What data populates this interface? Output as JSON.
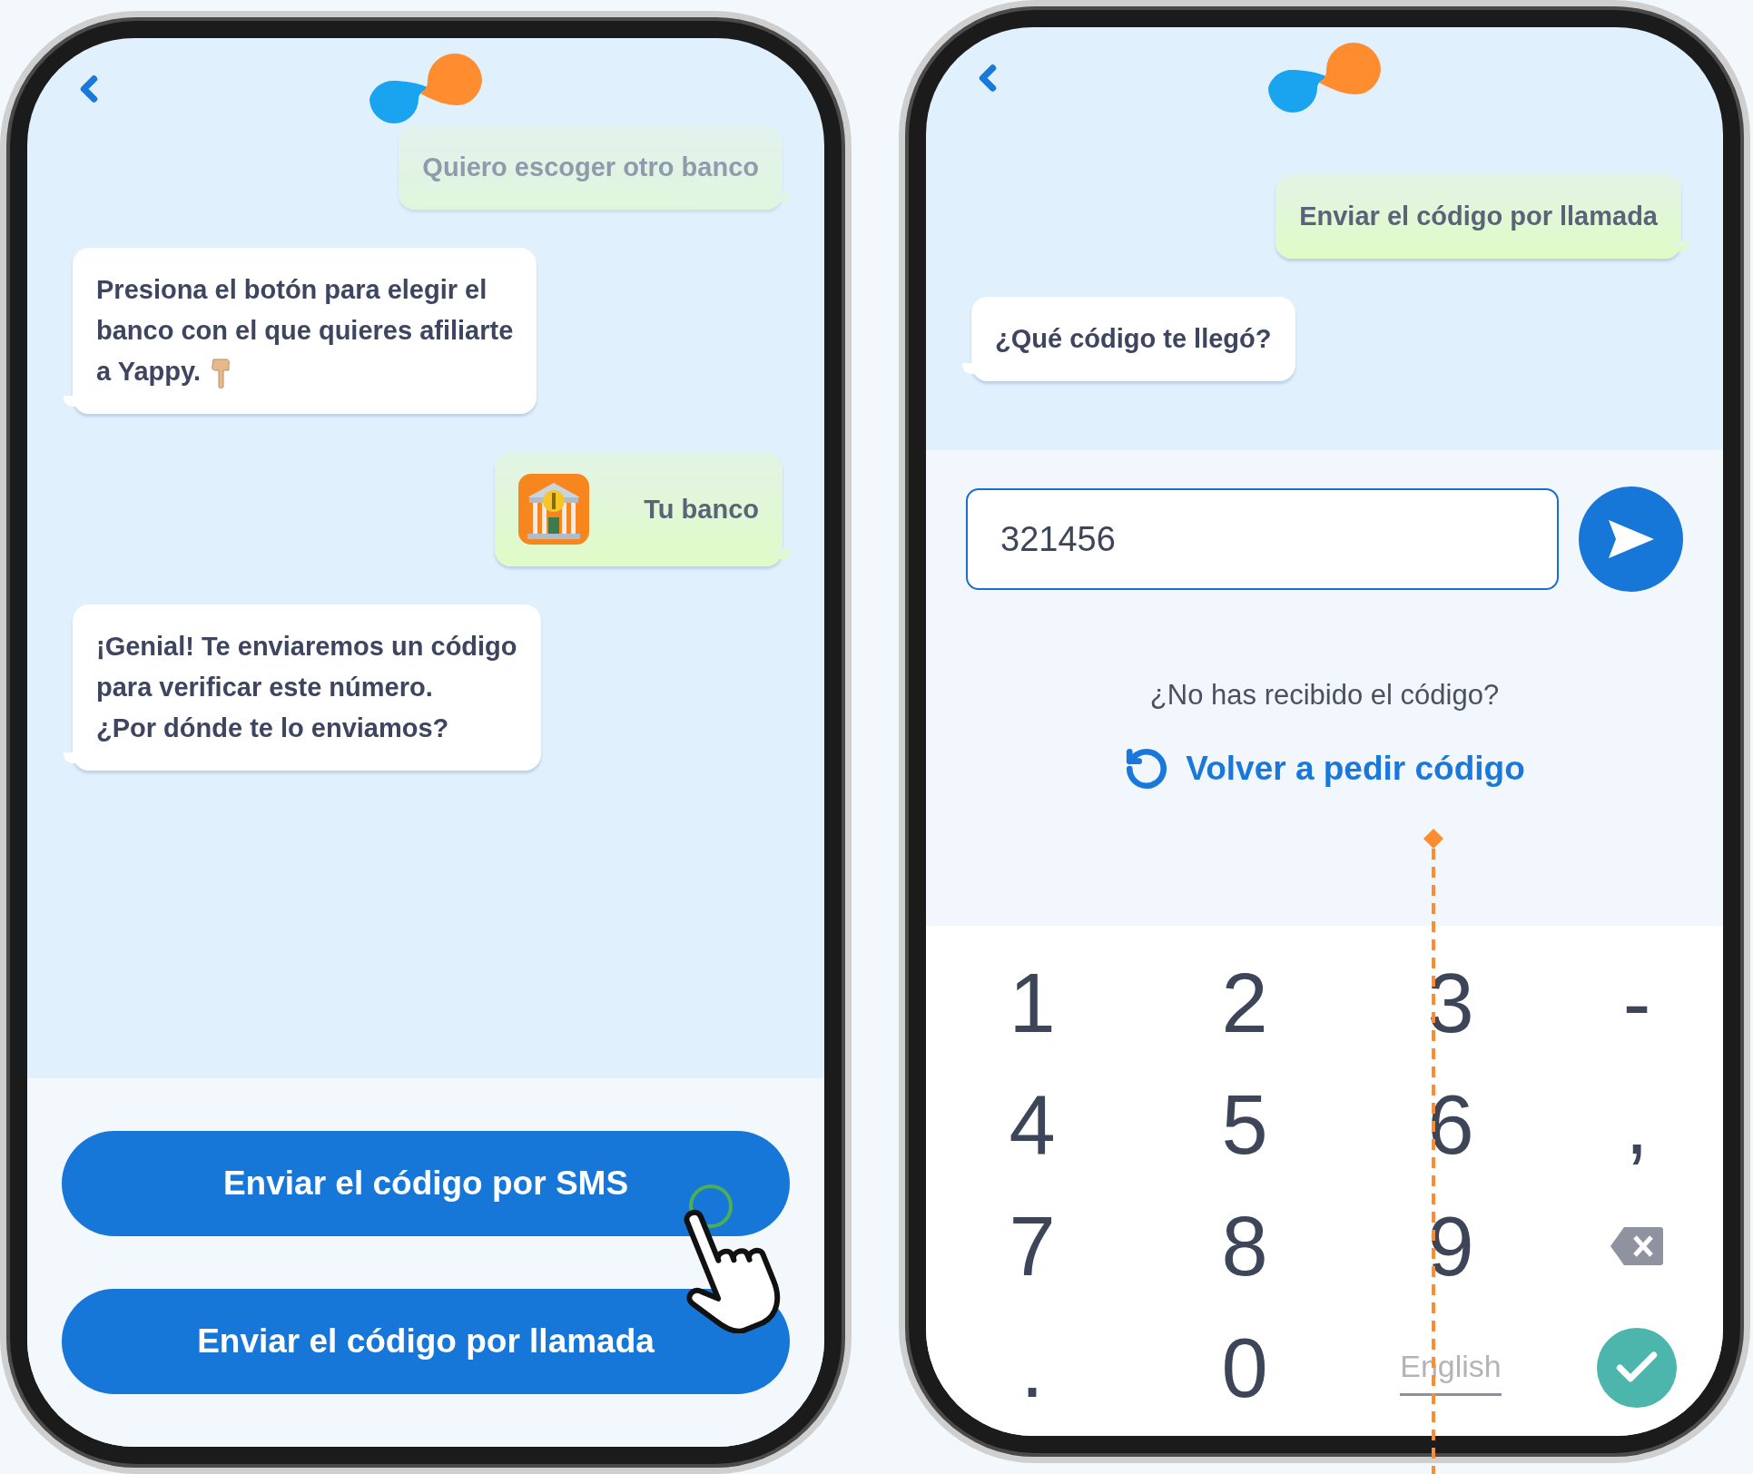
{
  "left_screen": {
    "chat": [
      {
        "kind": "faded",
        "outgoing": true,
        "text": "Quiero escoger otro banco"
      },
      {
        "kind": "text",
        "outgoing": false,
        "text": "Presiona el botón para elegir el\nbanco con el que quieres afiliarte\na Yappy."
      },
      {
        "kind": "bank",
        "outgoing": true,
        "text": "Tu banco"
      },
      {
        "kind": "text",
        "outgoing": false,
        "text": "¡Genial! Te enviaremos un código\npara verificar este número.\n¿Por dónde te lo enviamos?"
      }
    ],
    "buttons": [
      "Enviar el código por SMS",
      "Enviar el código por llamada"
    ]
  },
  "right_screen": {
    "chat": [
      {
        "outgoing": true,
        "text": "Enviar el código por llamada"
      },
      {
        "outgoing": false,
        "text": "¿Qué código te llegó?"
      }
    ],
    "code_input": {
      "value": "321456"
    },
    "hint": "¿No has recibido el código?",
    "resend_link": "Volver a pedir código",
    "keypad": [
      {
        "kind": "char",
        "label": "1"
      },
      {
        "kind": "char",
        "label": "2"
      },
      {
        "kind": "char",
        "label": "3"
      },
      {
        "kind": "char",
        "label": "-"
      },
      {
        "kind": "char",
        "label": "4"
      },
      {
        "kind": "char",
        "label": "5"
      },
      {
        "kind": "char",
        "label": "6"
      },
      {
        "kind": "char",
        "label": ","
      },
      {
        "kind": "char",
        "label": "7"
      },
      {
        "kind": "char",
        "label": "8"
      },
      {
        "kind": "char",
        "label": "9"
      },
      {
        "kind": "backspace"
      },
      {
        "kind": "char",
        "label": "."
      },
      {
        "kind": "char",
        "label": "0"
      },
      {
        "kind": "language",
        "label": "English"
      },
      {
        "kind": "done"
      }
    ]
  }
}
